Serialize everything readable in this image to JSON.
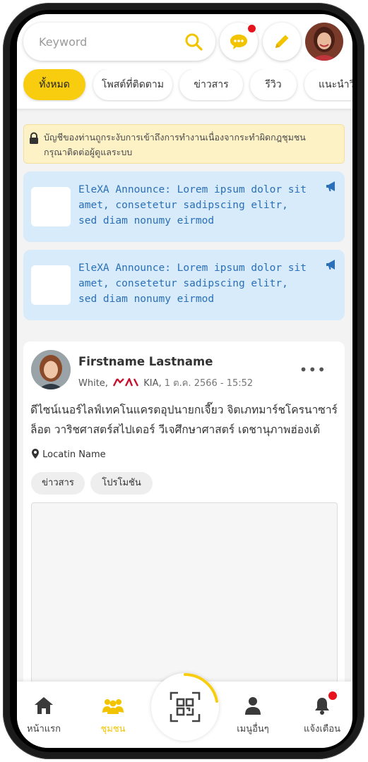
{
  "search": {
    "placeholder": "Keyword"
  },
  "tabs": [
    {
      "label": "ทั้งหมด"
    },
    {
      "label": "โพสต์ที่ติดตาม"
    },
    {
      "label": "ข่าวสาร"
    },
    {
      "label": "รีวิว"
    },
    {
      "label": "แนะนำวิ"
    }
  ],
  "alert": {
    "line1": "บัญชีของท่านถูกระงับการเข้าถึงการทำงานเนื่องจากระทำผิดกฎชุมชน",
    "line2": "กรุณาติดต่อผู้ดูแลระบบ"
  },
  "announcements": [
    {
      "text": "EleXA Announce: Lorem ipsum dolor sit amet, consetetur sadipscing elitr, sed diam nonumy eirmod"
    },
    {
      "text": "EleXA Announce: Lorem ipsum dolor sit amet, consetetur sadipscing elitr, sed diam nonumy eirmod"
    }
  ],
  "post": {
    "author": "Firstname Lastname",
    "color": "White,",
    "brand": "KIA,",
    "datetime": "1 ต.ค. 2566 - 15:52",
    "more": "•••",
    "body_line1": "ดีไซน์เนอร์ไลฟ์เทคโนแครตอุปนายกเจี๊ยว จิตเภทมาร์ชโครนาซาร์",
    "body_line2": "ล็อต วาริชศาสตร์สไปเดอร์ วีเจศึกษาศาสตร์ เดชานุภาพฮ่องเต้",
    "location": "Locatin Name",
    "tags": [
      "ข่าวสาร",
      "โปรโมชัน"
    ]
  },
  "nav": {
    "home": "หน้าแรก",
    "community": "ชุมชน",
    "more_menu": "เมนูอื่นๆ",
    "notifications": "แจ้งเตือน"
  },
  "colors": {
    "accent": "#f8cd0f",
    "announce_bg": "#d8ebfb",
    "announce_text": "#2a6fb7",
    "alert_bg": "#fdf1c6",
    "badge_red": "#e8121c",
    "kia_red": "#c8102e"
  },
  "icons": {
    "search": "search-icon",
    "chat": "chat-bubble-icon",
    "edit": "pencil-icon",
    "lock": "lock-icon",
    "megaphone": "megaphone-icon",
    "location": "map-pin-icon",
    "home": "home-icon",
    "community": "people-icon",
    "qr": "qr-scan-icon",
    "profile": "person-icon",
    "bell": "bell-icon"
  }
}
